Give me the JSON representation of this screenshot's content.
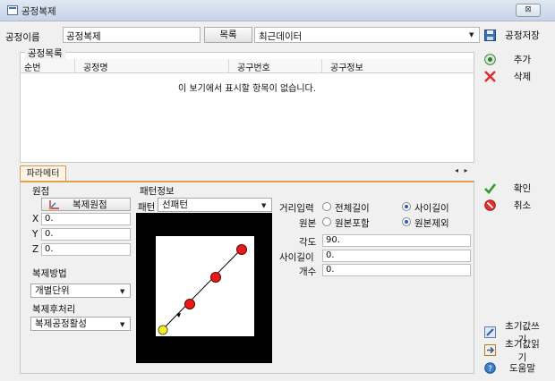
{
  "window": {
    "title": "공정복제",
    "close_label": "⊠"
  },
  "top": {
    "name_label": "공정이름",
    "name_value": "공정복제",
    "list_button": "목록",
    "recent_select": "최근데이터"
  },
  "toolbar": {
    "save": "공정저장",
    "add": "추가",
    "delete": "삭제",
    "ok": "확인",
    "cancel": "취소",
    "init_write": "초기값쓰기",
    "init_read": "초기값읽기",
    "help": "도움말"
  },
  "process_list": {
    "caption": "공정목록",
    "columns": [
      "순번",
      "공정명",
      "공구번호",
      "공구정보"
    ],
    "empty_message": "이 보기에서 표시할 항목이 없습니다."
  },
  "tabs": {
    "active": "파라메터",
    "arrows": "◂ ▸"
  },
  "params": {
    "origin_label": "원점",
    "copy_origin_button": "복제원점",
    "x_label": "X",
    "x_value": "0.",
    "y_label": "Y",
    "y_value": "0.",
    "z_label": "Z",
    "z_value": "0.",
    "copy_method_label": "복제방법",
    "copy_method_value": "개별단위",
    "post_copy_label": "복제후처리",
    "post_copy_value": "복제공정활성",
    "pattern_info_label": "패턴정보",
    "pattern_label": "패턴",
    "pattern_value": "선패턴",
    "distance_input_label": "거리입력",
    "distance_opt_total": "전체길이",
    "distance_opt_between": "사이길이",
    "distance_selected": "사이길이",
    "original_label": "원본",
    "original_opt_include": "원본포함",
    "original_opt_exclude": "원본제외",
    "original_selected": "원본제외",
    "angle_label": "각도",
    "angle_value": "90.",
    "between_length_label": "사이길이",
    "between_length_value": "0.",
    "count_label": "개수",
    "count_value": "0."
  },
  "colors": {
    "tab_accent": "#e3a14f",
    "pattern_bg": "#000000",
    "point_red": "#e81b1b",
    "point_yellow": "#f5ef1a"
  },
  "icons": {
    "save": "save-icon",
    "add": "add-icon",
    "delete": "delete-x-icon",
    "ok": "checkmark-icon",
    "cancel": "cancel-icon",
    "init_write": "init-write-icon",
    "init_read": "init-read-icon",
    "help": "help-icon",
    "copy_origin": "origin-axis-icon"
  }
}
